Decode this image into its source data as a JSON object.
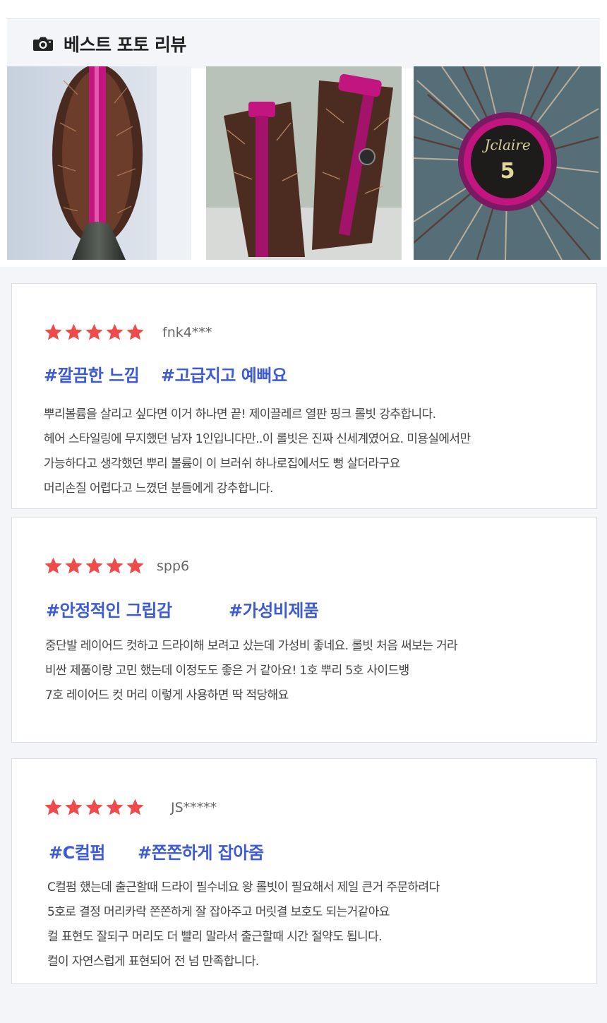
{
  "header": {
    "title": "베스트 포토 리뷰",
    "icon": "camera-icon"
  },
  "colors": {
    "star": "#ee4b4b",
    "tag": "#3e5bd6",
    "accent_pink": "#c2157f"
  },
  "photos": [
    {
      "alt": "round brush with pink core and dark handle"
    },
    {
      "alt": "two round brushes standing in a cup"
    },
    {
      "alt": "brush end cap engraved with number 5"
    }
  ],
  "reviews": [
    {
      "rating": 5,
      "user": "fnk4***",
      "tags": [
        "#깔끔한 느낌",
        "#고급지고 예뻐요"
      ],
      "lines": [
        "뿌리볼륨을 살리고 싶다면 이거 하나면 끝! 제이끌레르 열판 핑크 롤빗 강추합니다.",
        "헤어 스타일링에 무지했던 남자 1인입니다만..이 롤빗은 진짜 신세계였어요. 미용실에서만",
        "가능하다고 생각했던 뿌리 볼륨이 이 브러쉬 하나로집에서도 뻥 살더라구요",
        "머리손질 어렵다고 느꼈던 분들에게 강추합니다."
      ]
    },
    {
      "rating": 5,
      "user": "spp6",
      "tags": [
        "#안정적인 그립감",
        "#가성비제품"
      ],
      "lines": [
        "중단발 레이어드 컷하고 드라이해 보려고 샀는데 가성비 좋네요. 롤빗 처음 써보는 거라",
        "비싼 제품이랑 고민 했는데 이정도도 좋은 거 같아요! 1호 뿌리 5호 사이드뱅",
        "7호 레이어드 컷 머리 이렇게 사용하면 딱 적당해요"
      ]
    },
    {
      "rating": 5,
      "user": "JS*****",
      "tags": [
        "#C컬펌",
        "#쫀쫀하게 잡아줌"
      ],
      "lines": [
        "C컬펌 했는데 출근할때 드라이 필수네요 왕 롤빗이 필요해서 제일 큰거 주문하려다",
        "5호로 결정 머리카락 쫀쫀하게 잘 잡아주고 머릿결 보호도 되는거같아요",
        "컬 표현도 잘되구 머리도 더 빨리 말라서 출근할때 시간 절약도 됩니다.",
        "컬이 자연스럽게 표현되어 전 넘 만족합니다."
      ]
    }
  ]
}
